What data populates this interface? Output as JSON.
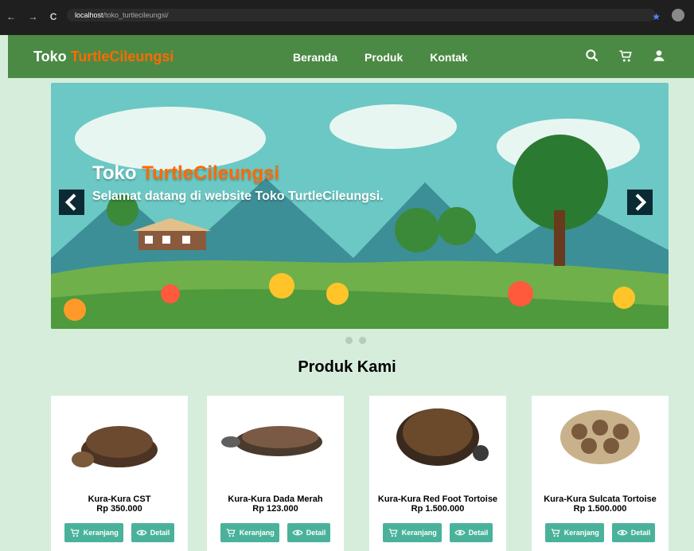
{
  "browser": {
    "nav_glyphs": [
      "←",
      "→",
      "C"
    ],
    "url_host": "localhost",
    "url_path": "/toko_turtlecileungsi/"
  },
  "navbar": {
    "brand_main": "Toko",
    "brand_accent": "TurtleCileungsi",
    "links": [
      "Beranda",
      "Produk",
      "Kontak"
    ],
    "icons": [
      "search-icon",
      "cart-icon",
      "user-icon"
    ],
    "bg_color": "#4b8a44",
    "accent_color": "#ff6a00"
  },
  "hero": {
    "title_main": "Toko",
    "title_accent": "TurtleCileungsi",
    "subtitle": "Selamat datang di website Toko TurtleCileungsi."
  },
  "section": {
    "title": "Produk Kami"
  },
  "products": [
    {
      "name": "Kura-Kura CST",
      "price": "Rp 350.000"
    },
    {
      "name": "Kura-Kura Dada Merah",
      "price": "Rp 123.000"
    },
    {
      "name": "Kura-Kura Red Foot Tortoise",
      "price": "Rp 1.500.000"
    },
    {
      "name": "Kura-Kura Sulcata Tortoise",
      "price": "Rp 1.500.000"
    }
  ],
  "buttons": {
    "cart": "Keranjang",
    "detail": "Detail"
  }
}
